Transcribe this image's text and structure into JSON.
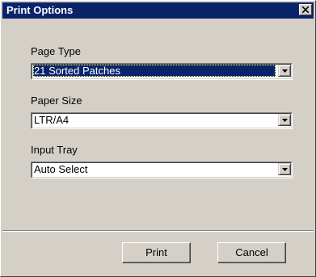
{
  "window": {
    "title": "Print Options",
    "close_icon": "close-icon"
  },
  "fields": {
    "page_type": {
      "label": "Page Type",
      "value": "21 Sorted Patches",
      "focused": true
    },
    "paper_size": {
      "label": "Paper Size",
      "value": "LTR/A4"
    },
    "input_tray": {
      "label": "Input Tray",
      "value": "Auto Select"
    }
  },
  "buttons": {
    "print": "Print",
    "cancel": "Cancel"
  },
  "colors": {
    "titlebar": "#0a246a",
    "face": "#d4d0c8",
    "selection": "#0a246a"
  }
}
